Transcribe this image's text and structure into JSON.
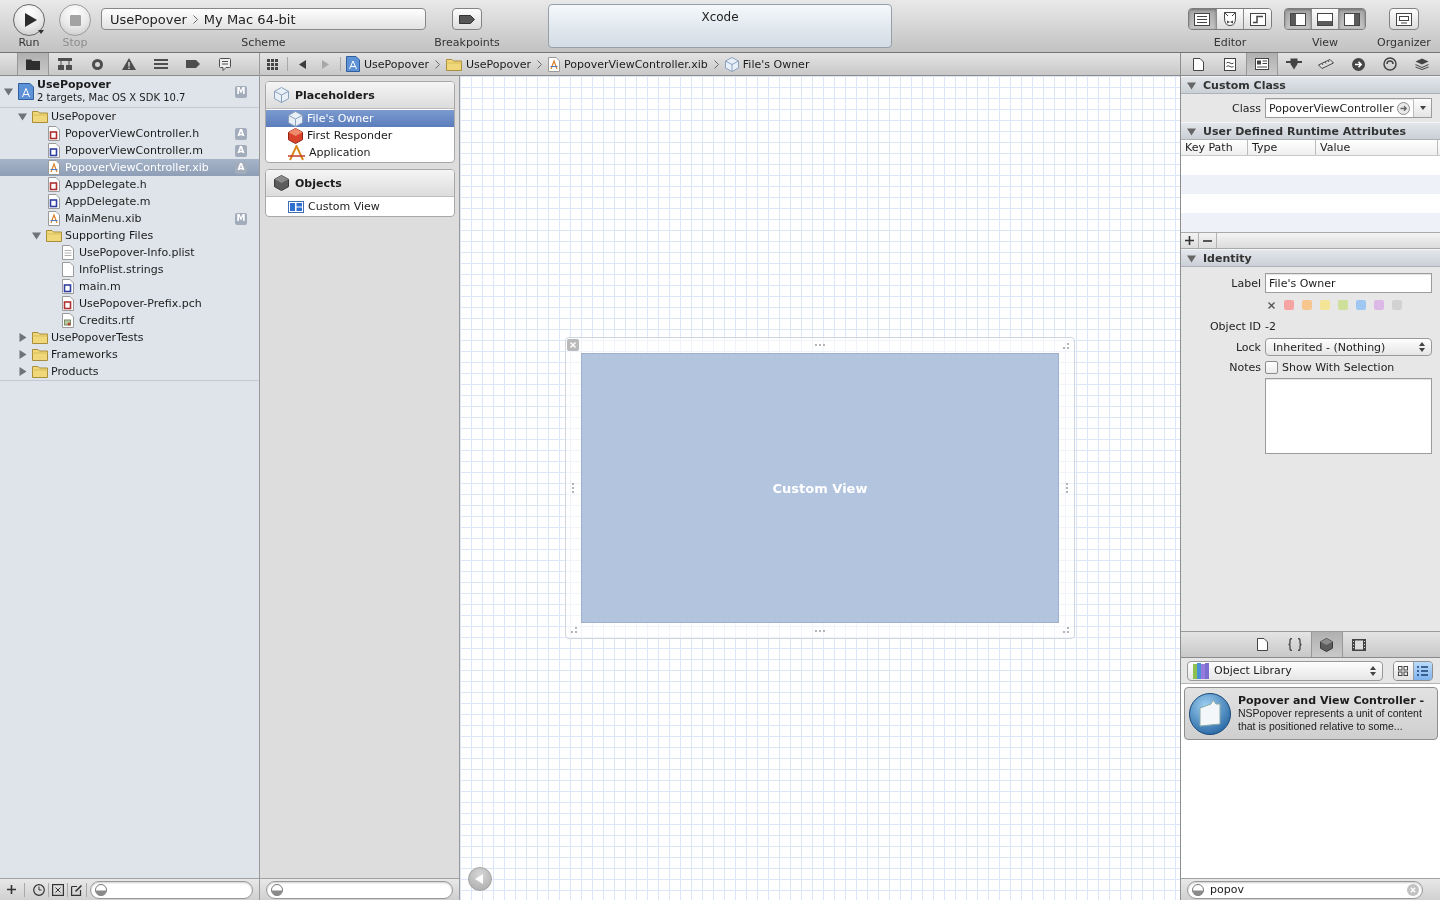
{
  "toolbar": {
    "run": {
      "label": "Run"
    },
    "stop": {
      "label": "Stop",
      "disabled": true
    },
    "scheme": {
      "label": "Scheme",
      "target": "UsePopover",
      "destination": "My Mac 64-bit"
    },
    "breakpoints": {
      "label": "Breakpoints"
    },
    "activity": {
      "title": "Xcode"
    },
    "editor": {
      "label": "Editor",
      "segments": [
        {
          "kind": "standard",
          "selected": true
        },
        {
          "kind": "assistant",
          "selected": false
        },
        {
          "kind": "version",
          "selected": false
        }
      ]
    },
    "view": {
      "label": "View",
      "segments": [
        {
          "kind": "navigator",
          "selected": true
        },
        {
          "kind": "debug",
          "selected": false
        },
        {
          "kind": "utilities",
          "selected": true
        }
      ]
    },
    "organizer": {
      "label": "Organizer"
    }
  },
  "navigator": {
    "tabs": [
      {
        "kind": "project",
        "selected": true
      },
      {
        "kind": "symbol",
        "selected": false
      },
      {
        "kind": "search",
        "selected": false
      },
      {
        "kind": "issue",
        "selected": false
      },
      {
        "kind": "debug",
        "selected": false
      },
      {
        "kind": "breakpoint",
        "selected": false
      },
      {
        "kind": "log",
        "selected": false
      }
    ],
    "tree": [
      {
        "kind": "project",
        "name": "UsePopover",
        "subtitle": "2 targets, Mac OS X SDK 10.7",
        "badge": "M",
        "expanded": true,
        "selected": false,
        "children": [
          {
            "kind": "folder",
            "name": "UsePopover",
            "expanded": true,
            "selected": false,
            "children": [
              {
                "kind": "header",
                "name": "PopoverViewController.h",
                "badge": "A",
                "selected": false
              },
              {
                "kind": "source",
                "name": "PopoverViewController.m",
                "badge": "A",
                "selected": false
              },
              {
                "kind": "interface",
                "name": "PopoverViewController.xib",
                "badge": "A",
                "selected": true
              },
              {
                "kind": "header",
                "name": "AppDelegate.h",
                "selected": false
              },
              {
                "kind": "source",
                "name": "AppDelegate.m",
                "selected": false
              },
              {
                "kind": "interface",
                "name": "MainMenu.xib",
                "badge": "M",
                "selected": false
              },
              {
                "kind": "folder",
                "name": "Supporting Files",
                "expanded": true,
                "selected": false,
                "children": [
                  {
                    "kind": "plist",
                    "name": "UsePopover-Info.plist",
                    "selected": false
                  },
                  {
                    "kind": "strings",
                    "name": "InfoPlist.strings",
                    "selected": false
                  },
                  {
                    "kind": "source",
                    "name": "main.m",
                    "selected": false
                  },
                  {
                    "kind": "header",
                    "name": "UsePopover-Prefix.pch",
                    "selected": false
                  },
                  {
                    "kind": "rtf",
                    "name": "Credits.rtf",
                    "selected": false
                  }
                ]
              }
            ]
          },
          {
            "kind": "folder",
            "name": "UsePopoverTests",
            "expanded": false,
            "selected": false
          },
          {
            "kind": "folder",
            "name": "Frameworks",
            "expanded": false,
            "selected": false
          },
          {
            "kind": "folder",
            "name": "Products",
            "expanded": false,
            "selected": false
          }
        ]
      }
    ]
  },
  "jump_bar": {
    "back": {
      "disabled": false
    },
    "forward": {
      "disabled": true
    },
    "crumbs": [
      {
        "kind": "project",
        "label": "UsePopover"
      },
      {
        "kind": "folder",
        "label": "UsePopover"
      },
      {
        "kind": "interface",
        "label": "PopoverViewController.xib"
      },
      {
        "kind": "placeholder",
        "label": "File's Owner"
      }
    ]
  },
  "outline": {
    "sections": [
      {
        "kind": "placeholders",
        "title": "Placeholders",
        "items": [
          {
            "kind": "owner",
            "label": "File's Owner",
            "selected": true
          },
          {
            "kind": "responder",
            "label": "First Responder",
            "selected": false
          },
          {
            "kind": "application",
            "label": "Application",
            "selected": false
          }
        ]
      },
      {
        "kind": "objects",
        "title": "Objects",
        "items": [
          {
            "kind": "view",
            "label": "Custom View",
            "selected": false
          }
        ]
      }
    ]
  },
  "canvas": {
    "view": {
      "label": "Custom View"
    }
  },
  "inspector": {
    "tabs": [
      {
        "kind": "file",
        "selected": false
      },
      {
        "kind": "quick-help",
        "selected": false
      },
      {
        "kind": "identity",
        "selected": true
      },
      {
        "kind": "attributes",
        "selected": false
      },
      {
        "kind": "size",
        "selected": false
      },
      {
        "kind": "connections",
        "selected": false
      },
      {
        "kind": "bindings",
        "selected": false
      },
      {
        "kind": "effects",
        "selected": false
      }
    ],
    "sections": [
      {
        "kind": "custom-class",
        "title": "Custom Class",
        "expanded": true,
        "class_label": "Class",
        "class_value": "PopoverViewController"
      },
      {
        "kind": "runtime-attributes",
        "title": "User Defined Runtime Attributes",
        "expanded": true,
        "columns": [
          "Key Path",
          "Type",
          "Value"
        ]
      },
      {
        "kind": "identity",
        "title": "Identity",
        "expanded": true,
        "label": {
          "label": "Label",
          "value": "File's Owner"
        },
        "colors": [
          {
            "color": "#f6a3a4",
            "selected": false
          },
          {
            "color": "#f7c68f",
            "selected": false
          },
          {
            "color": "#f3e595",
            "selected": false
          },
          {
            "color": "#cfe09a",
            "selected": false
          },
          {
            "color": "#9ec8f2",
            "selected": false
          },
          {
            "color": "#dcb8e6",
            "selected": false
          },
          {
            "color": "#d2d2d2",
            "selected": false
          }
        ],
        "object_id": {
          "label": "Object ID",
          "value": "-2"
        },
        "lock": {
          "label": "Lock",
          "value": "Inherited - (Nothing)"
        },
        "notes": {
          "label": "Notes",
          "checkbox": {
            "label": "Show With Selection",
            "checked": false
          }
        }
      }
    ]
  },
  "library": {
    "tabs": [
      {
        "kind": "file-templates",
        "selected": false
      },
      {
        "kind": "code-snippets",
        "selected": false
      },
      {
        "kind": "objects",
        "selected": true
      },
      {
        "kind": "media",
        "selected": false
      }
    ],
    "popup": "Object Library",
    "view_modes": [
      {
        "kind": "grid",
        "selected": false
      },
      {
        "kind": "list",
        "selected": true
      }
    ],
    "items": [
      {
        "title": "Popover and View Controller -",
        "description": "NSPopover represents a unit of content that is positioned relative to some...",
        "selected": true
      }
    ],
    "search": {
      "value": "popov"
    }
  }
}
